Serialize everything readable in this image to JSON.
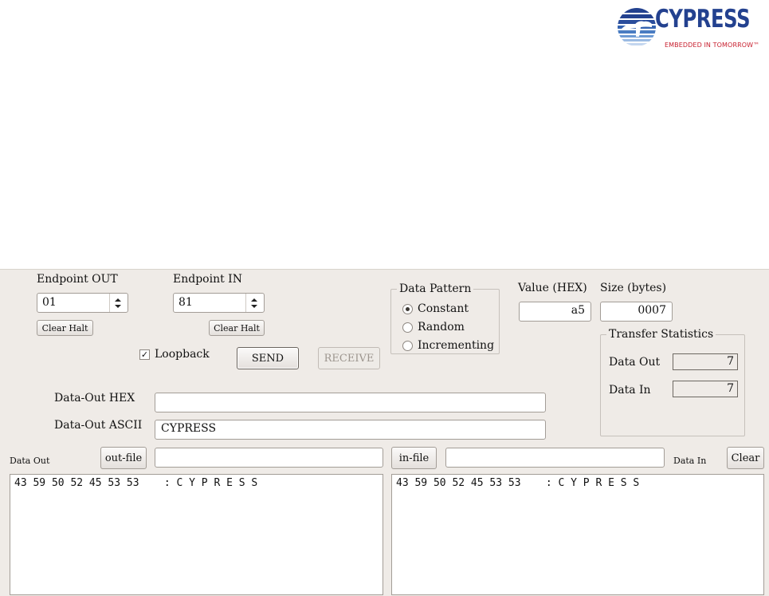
{
  "logo": {
    "wordmark": "CYPRESS",
    "tagline": "EMBEDDED IN TOMORROW™",
    "colors": {
      "blue": "#23418f",
      "red": "#c8202f"
    }
  },
  "endpoint_out": {
    "label": "Endpoint OUT",
    "value": "01",
    "clear_halt": "Clear Halt"
  },
  "endpoint_in": {
    "label": "Endpoint IN",
    "value": "81",
    "clear_halt": "Clear Halt"
  },
  "loopback": {
    "label": "Loopback",
    "checked": true
  },
  "send_label": "SEND",
  "receive_label": "RECEIVE",
  "data_pattern": {
    "legend": "Data Pattern",
    "options": [
      "Constant",
      "Random",
      "Incrementing"
    ],
    "selected": "Constant"
  },
  "value_hex": {
    "label": "Value (HEX)",
    "value": "a5"
  },
  "size_bytes": {
    "label": "Size (bytes)",
    "value": "0007"
  },
  "transfer_statistics": {
    "legend": "Transfer Statistics",
    "data_out_label": "Data Out",
    "data_out_value": "7",
    "data_in_label": "Data In",
    "data_in_value": "7"
  },
  "data_out_hex": {
    "label": "Data-Out HEX",
    "value": ""
  },
  "data_out_ascii": {
    "label": "Data-Out ASCII",
    "value": "CYPRESS"
  },
  "files": {
    "data_out_label": "Data Out",
    "out_file_button": "out-file",
    "out_file_path": "",
    "in_file_button": "in-file",
    "in_file_path": "",
    "data_in_label": "Data In",
    "clear_button": "Clear"
  },
  "log_out": "43 59 50 52 45 53 53    : C Y P R E S S",
  "log_in": "43 59 50 52 45 53 53    : C Y P R E S S"
}
